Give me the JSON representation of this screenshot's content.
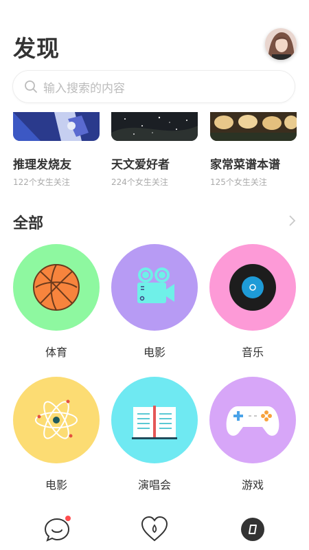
{
  "header": {
    "title": "发现"
  },
  "search": {
    "placeholder": "输入搜索的内容"
  },
  "topics": [
    {
      "name": "推理发烧友",
      "followers": "122个女生关注"
    },
    {
      "name": "天文爱好者",
      "followers": "224个女生关注"
    },
    {
      "name": "家常菜谱本谱",
      "followers": "125个女生关注"
    }
  ],
  "section": {
    "title": "全部"
  },
  "categories": [
    {
      "label": "体育",
      "color": "#8ef8a0",
      "icon": "basketball-icon"
    },
    {
      "label": "电影",
      "color": "#b79bf4",
      "icon": "movie-camera-icon"
    },
    {
      "label": "音乐",
      "color": "#fd9ad7",
      "icon": "vinyl-record-icon"
    },
    {
      "label": "电影",
      "color": "#fcdc73",
      "icon": "atom-icon"
    },
    {
      "label": "演唱会",
      "color": "#6fe9f2",
      "icon": "open-book-icon"
    },
    {
      "label": "游戏",
      "color": "#d7a6f8",
      "icon": "gamepad-icon"
    }
  ],
  "tabbar": {
    "items": [
      "chat-icon",
      "heart-icon",
      "compass-icon"
    ],
    "badge_color": "#ff4d4f"
  }
}
